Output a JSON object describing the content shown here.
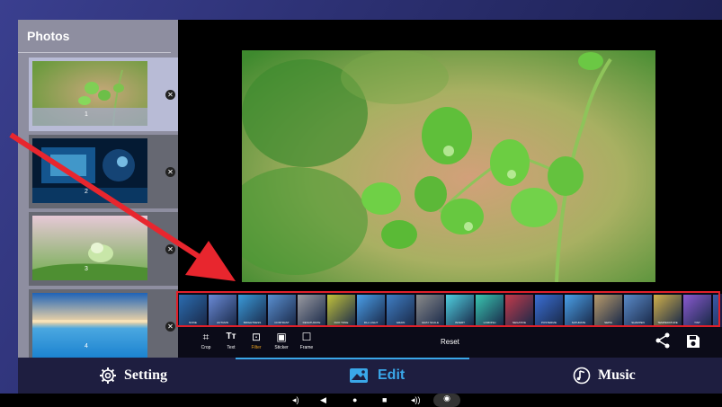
{
  "photos_panel": {
    "title": "Photos",
    "items": [
      {
        "number": "1",
        "selected": true
      },
      {
        "number": "2",
        "selected": false
      },
      {
        "number": "3",
        "selected": false
      },
      {
        "number": "4",
        "selected": false
      }
    ]
  },
  "filters": [
    "NONE",
    "AUTUMN",
    "BRIGHTNESS",
    "CONTRAST",
    "DESATURATE",
    "DUO TONE",
    "FILL LIGHT",
    "GRAIN",
    "GRAY SCALE",
    "INVERT",
    "LOMOISH",
    "NEGATIVE",
    "POSTERIZE",
    "SATURATE",
    "SEPIA",
    "SHARPEN",
    "TEMPERATURE",
    "TINT",
    "VIGNETTE"
  ],
  "toolbar": {
    "crop_label": "Crop",
    "text_label": "Text",
    "filter_label": "Filter",
    "sticker_label": "Sticker",
    "frame_label": "Frame",
    "reset_label": "Reset",
    "active_tool": "Filter"
  },
  "tabs": {
    "setting_label": "Setting",
    "edit_label": "Edit",
    "music_label": "Music",
    "active": "Edit"
  },
  "colors": {
    "accent": "#3aa7e8",
    "active_tool": "#e8a020",
    "highlight_border": "#e0202a",
    "arrow": "#e8262e"
  }
}
